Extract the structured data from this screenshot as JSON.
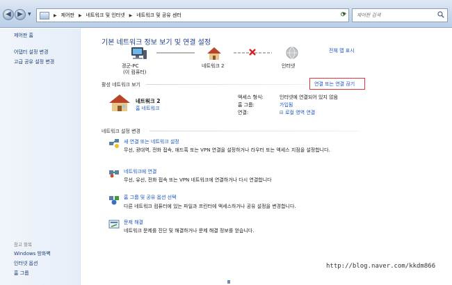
{
  "address_bar": {
    "crumbs": [
      "제어판",
      "네트워크 및 인터넷",
      "네트워크 및 공유 센터"
    ],
    "search_placeholder": "제어판 검색"
  },
  "sidebar": {
    "home": "제어판 홈",
    "links": [
      "어댑터 설정 변경",
      "고급 공유 설정 변경"
    ],
    "see_also_heading": "참고 항목",
    "see_also": [
      "Windows 방화벽",
      "인터넷 옵션",
      "홈 그룹"
    ]
  },
  "main": {
    "title": "기본 네트워크 정보 보기 및 연결 설정",
    "full_map_link": "전체 맵 표시",
    "map_nodes": {
      "pc": "경군-PC",
      "pc_sub": "(이 컴퓨터)",
      "network": "네트워크 2",
      "internet": "인터넷"
    },
    "active_networks": {
      "label": "활성 네트워크 보기",
      "connect_link": "연결 또는 연결 끊기",
      "name": "네트워크 2",
      "type": "홈 네트워크",
      "access_type_label": "액세스 형식:",
      "access_type_value": "인터넷에 연결되어 있지 않음",
      "homegroup_label": "홈 그룹:",
      "homegroup_value": "가입됨",
      "connections_label": "연결:",
      "connections_value": "로컬 영역 연결"
    },
    "change_settings": {
      "label": "네트워크 설정 변경",
      "tasks": [
        {
          "title": "새 연결 또는 네트워크 설정",
          "desc": "무선, 광대역, 전화 접속, 애드혹 또는 VPN 연결을 설정하거나 라우터 또는 액세스 지점을 설정합니다."
        },
        {
          "title": "네트워크에 연결",
          "desc": "무선, 유선, 전화 접속 또는 VPN 네트워크에 연결하거나 다시 연결합니다"
        },
        {
          "title": "홈 그룹 및 공유 옵션 선택",
          "desc": "다른 네트워크 컴퓨터에 있는 파일과 프린터에 액세스하거나 공유 설정을 변경합니다."
        },
        {
          "title": "문제 해결",
          "desc": "네트워크 문제를 진단 및 해결하거나 문제 해결 정보를 얻습니다."
        }
      ]
    }
  },
  "watermark": "http://blog.naver.com/kkdm866",
  "colors": {
    "link": "#1a55c4",
    "title": "#1e3f8a",
    "highlight_box": "#e33636"
  }
}
